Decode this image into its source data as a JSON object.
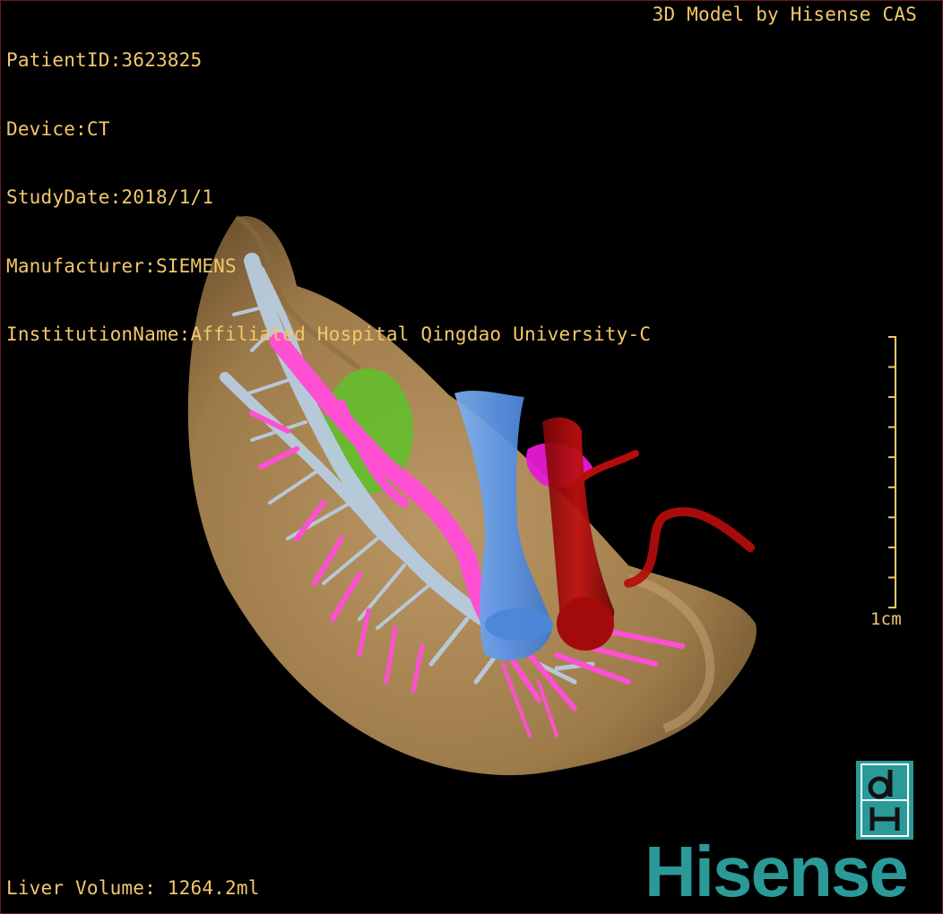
{
  "study_info": {
    "patient_id": "PatientID:3623825",
    "device": "Device:CT",
    "study_date": "StudyDate:2018/1/1",
    "manufacturer": "Manufacturer:SIEMENS",
    "institution": "InstitutionName:Affiliated Hospital Qingdao University-C"
  },
  "model_credit": "3D Model by Hisense CAS",
  "liver_volume": "Liver Volume: 1264.2ml",
  "scale_bar": {
    "label": "1cm",
    "ticks": 10
  },
  "brand": {
    "name": "Hisense",
    "logo_letters": "dH"
  },
  "colors": {
    "text": "#f2c86a",
    "liver": "#b08a55",
    "portal_vein": "#ff4fd2",
    "hepatic_vein": "#b8cce0",
    "tumor": "#5fc02a",
    "ivc": "#5a95e8",
    "aorta": "#b50c0c",
    "gallbladder": "#e61ad6",
    "brand": "#2a9a98"
  },
  "icons": {
    "logo": "hisense-dh-logo-icon"
  }
}
